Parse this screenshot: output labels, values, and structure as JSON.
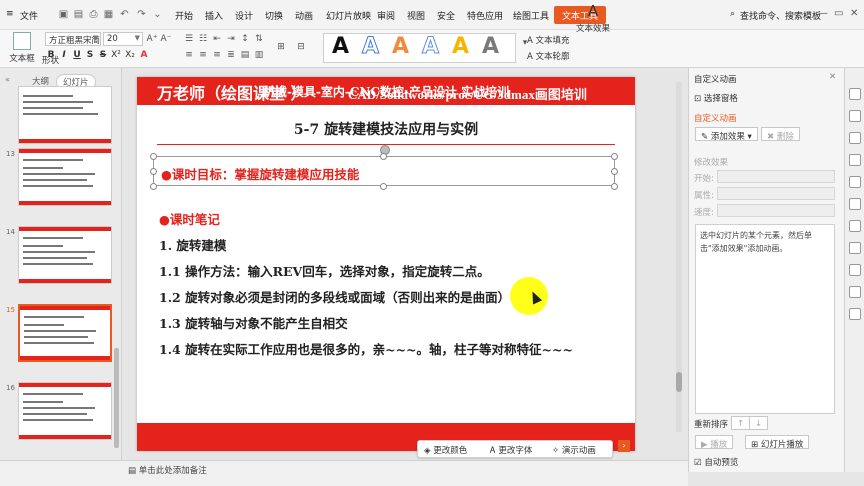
{
  "menu": {
    "file": "文件",
    "tabs": [
      "开始",
      "插入",
      "设计",
      "切换",
      "动画",
      "幻灯片放映",
      "审阅",
      "视图",
      "安全",
      "特色应用",
      "绘图工具"
    ],
    "active_tab": "文本工具",
    "search": "查找命令、搜索模板"
  },
  "ribbon": {
    "textbox": "文本框",
    "shape": "形状",
    "font_name": "方正粗黑宋简体",
    "font_size": "20",
    "fill": "文本填充",
    "outline": "文本轮廓",
    "effect": "文本效果",
    "style_colors": [
      "#111111",
      "#3b7ddd",
      "#f08a3c",
      "#5b8fe0",
      "#f7b500",
      "#7a7a7a"
    ],
    "style_glyph": "A"
  },
  "leftpane": {
    "tab_outline": "大纲",
    "tab_slides": "幻灯片",
    "thumb_numbers": [
      "13",
      "14",
      "15",
      "16"
    ],
    "add": "+"
  },
  "slide": {
    "header_left": "万老师（绘图课堂 ）",
    "header_right": "CAD/Solidworks/proe/UG/3dmax画图培训",
    "title": "5-7 旋转建模技法应用与实例",
    "goal": "●课时目标：掌握旋转建模应用技能",
    "notes": [
      "●课时笔记",
      "1. 旋转建模",
      "1.1 操作方法：输入REV回车，选择对象，指定旋转二点。",
      "1.2 旋转对象必须是封闭的多段线或面域（否则出来的是曲面）",
      "1.3 旋转轴与对象不能产生自相交",
      "1.4 旋转在实际工作应用也是很多的，亲~~~。轴，柱子等对称特征~~~"
    ],
    "footer": "机械-模具-室内-CNC数控-产品设计    实战培训"
  },
  "floatbar": {
    "color": "更改颜色",
    "font": "更改字体",
    "demo": "演示动画"
  },
  "rightpane": {
    "title": "自定义动画",
    "select_pane": "选择窗格",
    "section": "自定义动画",
    "add_effect": "添加效果",
    "delete": "删除",
    "modify": "修改效果",
    "start": "开始:",
    "property": "属性:",
    "speed": "速度:",
    "hint": "选中幻灯片的某个元素，然后单击\"添加效果\"添加动画。",
    "reorder": "重新排序",
    "play": "播放",
    "slideshow": "幻灯片播放",
    "autopreview": "自动预览"
  },
  "status": {
    "note": "单击此处添加备注"
  },
  "colors": {
    "accent": "#e85a22",
    "slide_red": "#e4231d"
  }
}
